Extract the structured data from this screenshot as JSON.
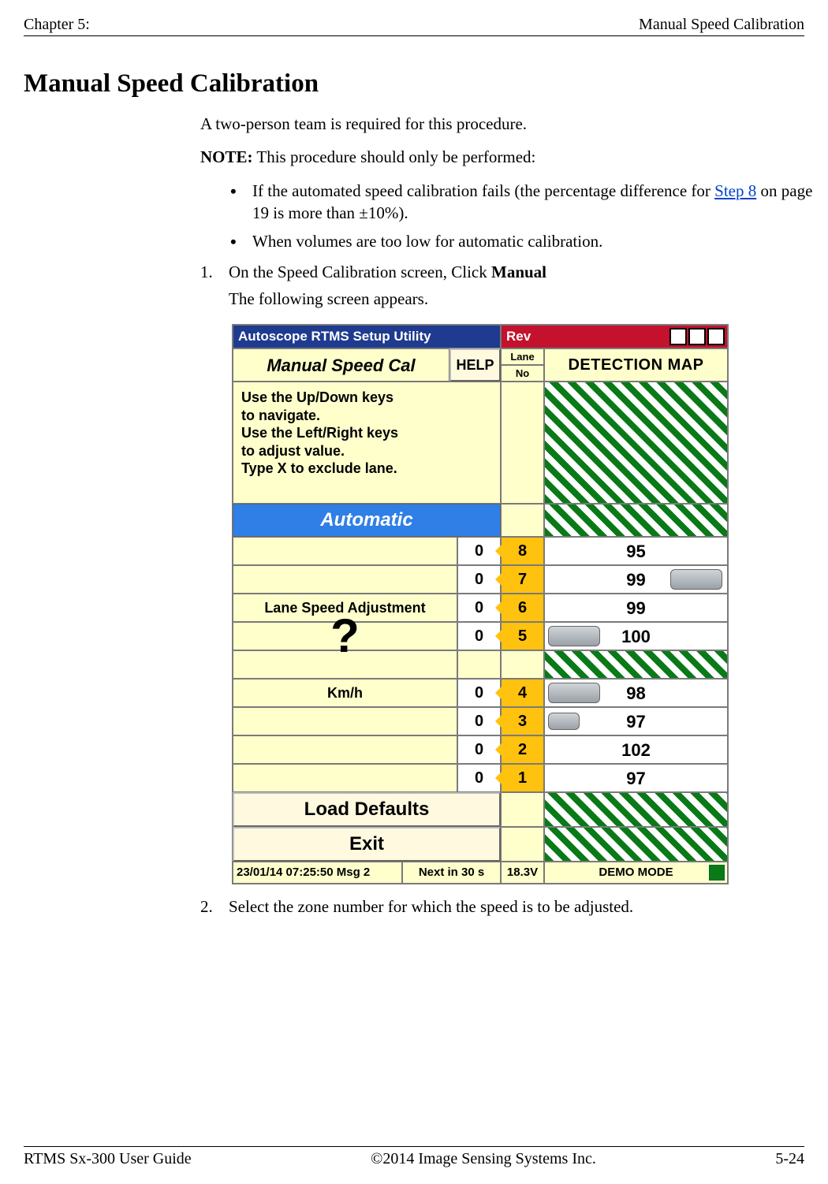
{
  "header": {
    "left": "Chapter 5:",
    "right": "Manual Speed Calibration"
  },
  "title": "Manual Speed Calibration",
  "intro": "A two-person team is required for this procedure.",
  "note_label": "NOTE:",
  "note_text": "  This procedure should only be performed:",
  "bullet1_a": " If the automated speed calibration fails (the percentage difference for ",
  "bullet1_link": "Step 8",
  "bullet1_b": " on page 19 is more than ±10%).",
  "bullet2": "When volumes are too low for automatic calibration.",
  "step1_num": "1.",
  "step1_a": "On the Speed Calibration screen, Click ",
  "step1_b": "Manual",
  "step1_follow": "The following screen appears.",
  "step2_num": "2.",
  "step2": "Select the zone number for which the speed is to be adjusted.",
  "footer": {
    "left": "RTMS Sx-300 User Guide",
    "center": "©2014 Image Sensing Systems Inc.",
    "right": "5-24"
  },
  "ui": {
    "titlebar_left": "Autoscope RTMS Setup Utility",
    "titlebar_right": "Rev",
    "panel_title": "Manual Speed Cal",
    "help": "HELP",
    "lane": "Lane",
    "no": "No",
    "detection_map": "DETECTION MAP",
    "instructions": "Use the Up/Down keys\nto navigate.\nUse the Left/Right keys\nto adjust value.\nType X to exclude lane.",
    "automatic": "Automatic",
    "lane_speed_adj": "Lane Speed Adjustment",
    "kmh": "Km/h",
    "load_defaults": "Load Defaults",
    "exit": "Exit",
    "lanes": [
      {
        "adj": "0",
        "no": "8",
        "val": "95",
        "car": null
      },
      {
        "adj": "0",
        "no": "7",
        "val": "99",
        "car": "right"
      },
      {
        "adj": "0",
        "no": "6",
        "val": "99",
        "car": null
      },
      {
        "adj": "0",
        "no": "5",
        "val": "100",
        "car": "near"
      },
      {
        "adj": "0",
        "no": "4",
        "val": "98",
        "car": "near"
      },
      {
        "adj": "0",
        "no": "3",
        "val": "97",
        "car": "near-small"
      },
      {
        "adj": "0",
        "no": "2",
        "val": "102",
        "car": null
      },
      {
        "adj": "0",
        "no": "1",
        "val": "97",
        "car": null
      }
    ],
    "status": {
      "timestamp": "23/01/14 07:25:50 Msg 2",
      "next": "Next in 30 s",
      "volt": "18.3V",
      "mode": "DEMO MODE"
    }
  }
}
